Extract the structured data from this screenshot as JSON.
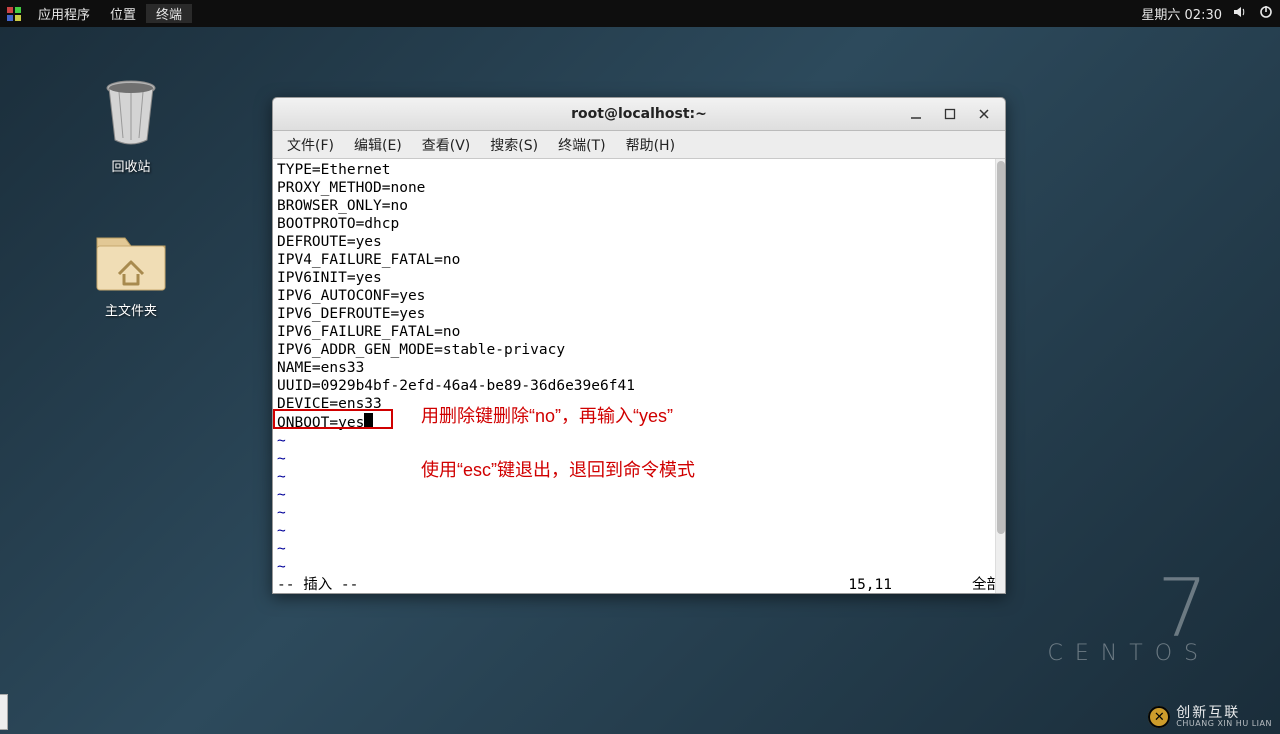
{
  "panel": {
    "apps": "应用程序",
    "places": "位置",
    "terminal": "终端",
    "clock": "星期六 02:30"
  },
  "desktop": {
    "trash": "回收站",
    "home": "主文件夹"
  },
  "window": {
    "title": "root@localhost:~",
    "menu": {
      "file": "文件(F)",
      "edit": "编辑(E)",
      "view": "查看(V)",
      "search": "搜索(S)",
      "terminal": "终端(T)",
      "help": "帮助(H)"
    },
    "content_lines": [
      "TYPE=Ethernet",
      "PROXY_METHOD=none",
      "BROWSER_ONLY=no",
      "BOOTPROTO=dhcp",
      "DEFROUTE=yes",
      "IPV4_FAILURE_FATAL=no",
      "IPV6INIT=yes",
      "IPV6_AUTOCONF=yes",
      "IPV6_DEFROUTE=yes",
      "IPV6_FAILURE_FATAL=no",
      "IPV6_ADDR_GEN_MODE=stable-privacy",
      "NAME=ens33",
      "UUID=0929b4bf-2efd-46a4-be89-36d6e39e6f41",
      "DEVICE=ens33"
    ],
    "highlighted_line": "ONBOOT=yes",
    "status": {
      "mode": "-- 插入 --",
      "pos": "15,11",
      "scope": "全部"
    }
  },
  "annotations": {
    "line1": "用删除键删除“no”，再输入“yes”",
    "line2": "使用“esc”键退出，退回到命令模式"
  },
  "brand": {
    "version": "7",
    "name": "CENTOS"
  },
  "watermark": {
    "cn": "创新互联",
    "en": "CHUANG XIN HU LIAN"
  }
}
